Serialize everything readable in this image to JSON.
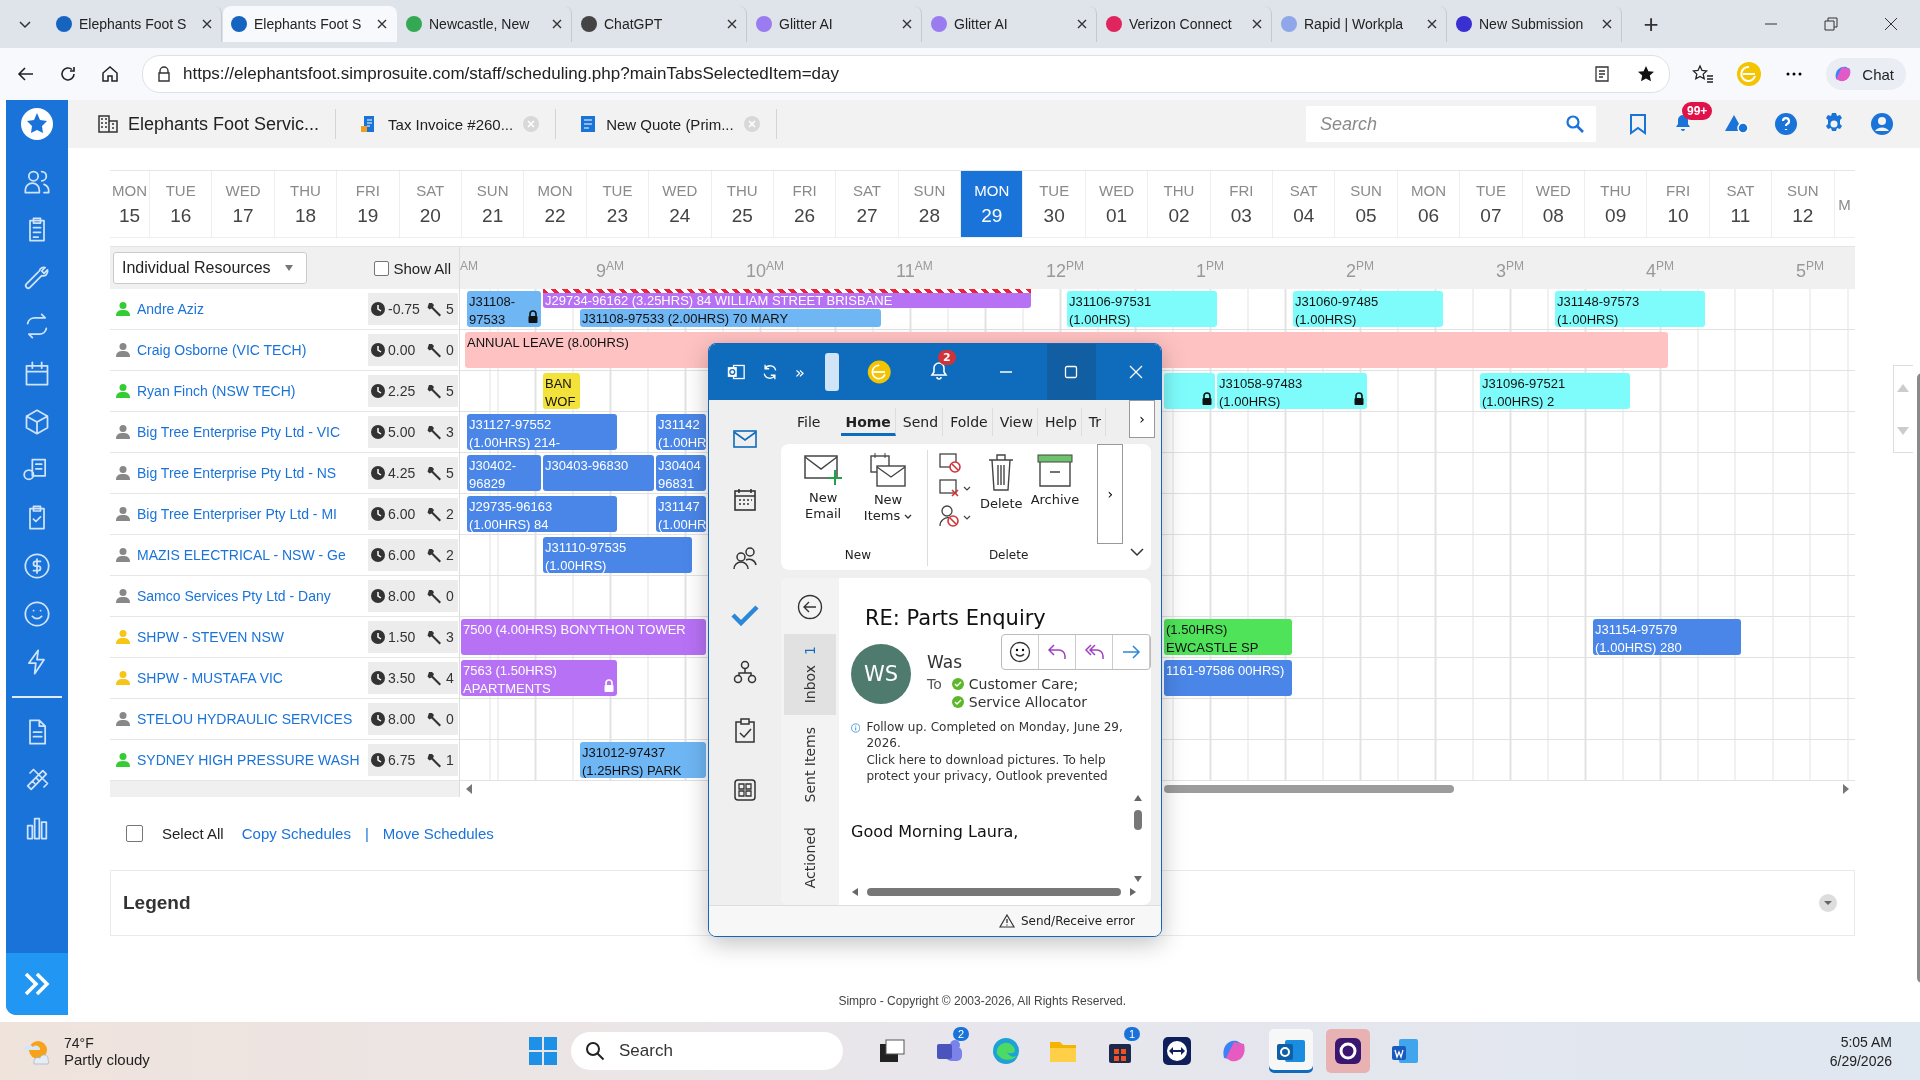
{
  "browser": {
    "tabs": [
      {
        "title": "Elephants Foot S",
        "selected": false,
        "color": "#1565c0"
      },
      {
        "title": "Elephants Foot S",
        "selected": true,
        "color": "#1565c0"
      },
      {
        "title": "Newcastle, New",
        "selected": false,
        "color": "#34a853"
      },
      {
        "title": "ChatGPT",
        "selected": false,
        "color": "#444444"
      },
      {
        "title": "Glitter AI",
        "selected": false,
        "color": "#9b7bf0"
      },
      {
        "title": "Glitter AI",
        "selected": false,
        "color": "#9b7bf0"
      },
      {
        "title": "Verizon Connect",
        "selected": false,
        "color": "#e0245e"
      },
      {
        "title": "Rapid | Workpla",
        "selected": false,
        "color": "#8fa6e8"
      },
      {
        "title": "New Submission",
        "selected": false,
        "color": "#3a2fd0"
      }
    ],
    "new_tab": "+",
    "address": "https://elephantsfoot.simprosuite.com/staff/scheduling.php?mainTabsSelectedItem=day",
    "chat": "Chat"
  },
  "app_header": {
    "tabs": [
      {
        "label": "Elephants Foot Servic...",
        "kind": "company"
      },
      {
        "label": "Tax Invoice #260...",
        "kind": "invoice"
      },
      {
        "label": "New Quote (Prim...",
        "kind": "quote"
      }
    ],
    "search": {
      "placeholder": "Search"
    },
    "notifications": "99+"
  },
  "dates": [
    {
      "weekday": "MON",
      "day": "15",
      "selected": false
    },
    {
      "weekday": "TUE",
      "day": "16",
      "selected": false
    },
    {
      "weekday": "WED",
      "day": "17",
      "selected": false
    },
    {
      "weekday": "THU",
      "day": "18",
      "selected": false
    },
    {
      "weekday": "FRI",
      "day": "19",
      "selected": false
    },
    {
      "weekday": "SAT",
      "day": "20",
      "selected": false
    },
    {
      "weekday": "SUN",
      "day": "21",
      "selected": false
    },
    {
      "weekday": "MON",
      "day": "22",
      "selected": false
    },
    {
      "weekday": "TUE",
      "day": "23",
      "selected": false
    },
    {
      "weekday": "WED",
      "day": "24",
      "selected": false
    },
    {
      "weekday": "THU",
      "day": "25",
      "selected": false
    },
    {
      "weekday": "FRI",
      "day": "26",
      "selected": false
    },
    {
      "weekday": "SAT",
      "day": "27",
      "selected": false
    },
    {
      "weekday": "SUN",
      "day": "28",
      "selected": false
    },
    {
      "weekday": "MON",
      "day": "29",
      "selected": true
    },
    {
      "weekday": "TUE",
      "day": "30",
      "selected": false
    },
    {
      "weekday": "WED",
      "day": "01",
      "selected": false
    },
    {
      "weekday": "THU",
      "day": "02",
      "selected": false
    },
    {
      "weekday": "FRI",
      "day": "03",
      "selected": false
    },
    {
      "weekday": "SAT",
      "day": "04",
      "selected": false
    },
    {
      "weekday": "SUN",
      "day": "05",
      "selected": false
    },
    {
      "weekday": "MON",
      "day": "06",
      "selected": false
    },
    {
      "weekday": "TUE",
      "day": "07",
      "selected": false
    },
    {
      "weekday": "WED",
      "day": "08",
      "selected": false
    },
    {
      "weekday": "THU",
      "day": "09",
      "selected": false
    },
    {
      "weekday": "FRI",
      "day": "10",
      "selected": false
    },
    {
      "weekday": "SAT",
      "day": "11",
      "selected": false
    },
    {
      "weekday": "SUN",
      "day": "12",
      "selected": false
    },
    {
      "weekday": "M",
      "selected": false
    }
  ],
  "scheduler": {
    "mode": "Individual Resources",
    "show_all": {
      "label": "Show All",
      "checked": false
    },
    "hours": [
      "$^{AM}$",
      "9$^{AM}$",
      "10$^{AM}$",
      "11$^{AM}$",
      "12$^{PM}$",
      "1$^{PM}$",
      "2$^{PM}$",
      "3$^{PM}$",
      "4$^{PM}$",
      "5$^{PM}$"
    ],
    "rows": [
      {
        "name": "Andre Aziz",
        "color": "#33cc33",
        "hours": "-0.75",
        "jobs_count": "5",
        "jobs": [
          {
            "text": "J31108-97533",
            "kind": "full",
            "color": "#6fb6f5",
            "locked": true,
            "flagged": false
          },
          {
            "text": "J29734-96162 (3.25HRS) 84 WILLIAM STREET BRISBANE",
            "kind": "top",
            "color": "#b771f5",
            "locked": false,
            "flagged": true
          },
          {
            "text": "J31108-97533 (2.00HRS) 70 MARY",
            "kind": "bottom",
            "color": "#6fb6f5",
            "locked": false,
            "flagged": false
          },
          {
            "text": "J31106-97531 (1.00HRS)",
            "kind": "full",
            "color": "#7efcfc",
            "locked": false,
            "flagged": false
          },
          {
            "text": "J31060-97485 (1.00HRS)",
            "kind": "full",
            "color": "#7efcfc",
            "locked": false,
            "flagged": false
          },
          {
            "text": "J31148-97573 (1.00HRS)",
            "kind": "full",
            "color": "#7efcfc",
            "locked": false,
            "flagged": false
          }
        ]
      },
      {
        "name": "Craig Osborne (VIC TECH)",
        "color": "#888888",
        "hours": "0.00",
        "jobs_count": "0",
        "jobs": [
          {
            "text": "ANNUAL LEAVE (8.00HRS)",
            "kind": "full",
            "color": "#ffc2c2",
            "locked": false,
            "flagged": false
          }
        ]
      },
      {
        "name": "Ryan Finch (NSW TECH)",
        "color": "#33cc33",
        "hours": "2.25",
        "jobs_count": "5",
        "jobs": [
          {
            "text": "BAN WOF",
            "kind": "full",
            "color": "#f3e23a",
            "locked": false,
            "flagged": false
          },
          {
            "kind": "full",
            "color": "#7efcfc",
            "locked": true,
            "flagged": false
          },
          {
            "text": "J31058-97483 (1.00HRS)",
            "kind": "full",
            "color": "#7efcfc",
            "locked": true,
            "flagged": false
          },
          {
            "text": "J31096-97521 (1.00HRS) 2",
            "kind": "full",
            "color": "#7efcfc",
            "locked": false,
            "flagged": false
          }
        ]
      },
      {
        "name": "Big Tree Enterprise Pty Ltd - VIC",
        "color": "#888888",
        "hours": "5.00",
        "jobs_count": "3",
        "jobs": [
          {
            "text": "J31127-97552 (1.00HRS) 214-",
            "kind": "full",
            "color": "#4a86e8",
            "locked": false,
            "flagged": false
          },
          {
            "text": "J31142 (1.00HR",
            "kind": "full",
            "color": "#4a86e8",
            "locked": false,
            "flagged": false
          }
        ]
      },
      {
        "name": "Big Tree Enterprise Pty Ltd - NS",
        "color": "#888888",
        "hours": "4.25",
        "jobs_count": "5",
        "jobs": [
          {
            "text": "J30402-96829",
            "kind": "full",
            "color": "#4a86e8",
            "locked": false,
            "flagged": false
          },
          {
            "text": "J30403-96830",
            "kind": "full",
            "color": "#4a86e8",
            "locked": false,
            "flagged": false
          },
          {
            "text": "J30404 96831",
            "kind": "full",
            "color": "#4a86e8",
            "locked": false,
            "flagged": false
          }
        ]
      },
      {
        "name": "Big Tree Enterpriser Pty Ltd - MI",
        "color": "#888888",
        "hours": "6.00",
        "jobs_count": "2",
        "jobs": [
          {
            "text": "J29735-96163 (1.00HRS) 84",
            "kind": "full",
            "color": "#4a86e8",
            "locked": false,
            "flagged": false
          },
          {
            "text": "J31147 (1.00HR",
            "kind": "full",
            "color": "#4a86e8",
            "locked": false,
            "flagged": false
          }
        ]
      },
      {
        "name": "MAZIS ELECTRICAL - NSW - Ge",
        "color": "#888888",
        "hours": "6.00",
        "jobs_count": "2",
        "jobs": [
          {
            "text": "J31110-97535 (1.00HRS)",
            "kind": "full",
            "color": "#4a86e8",
            "locked": false,
            "flagged": false
          }
        ]
      },
      {
        "name": "Samco Services Pty Ltd - Dany",
        "color": "#888888",
        "hours": "8.00",
        "jobs_count": "0",
        "jobs": []
      },
      {
        "name": "SHPW - STEVEN NSW",
        "color": "#f5c518",
        "hours": "1.50",
        "jobs_count": "3",
        "jobs": [
          {
            "text": "7500 (4.00HRS) BONYTHON TOWER",
            "kind": "full",
            "color": "#b771f5",
            "locked": false,
            "flagged": false
          },
          {
            "text": "(1.50HRS) EWCASTLE SP",
            "kind": "full",
            "color": "#4fe35a",
            "locked": false,
            "flagged": false
          },
          {
            "text": "J31154-97579 (1.00HRS) 280",
            "kind": "full",
            "color": "#4a86e8",
            "locked": false,
            "flagged": false
          }
        ]
      },
      {
        "name": "SHPW - MUSTAFA VIC",
        "color": "#f5c518",
        "hours": "3.50",
        "jobs_count": "4",
        "jobs": [
          {
            "text": "7563 (1.50HRS) APARTMENTS",
            "kind": "full",
            "color": "#b771f5",
            "locked": true,
            "flagged": false
          },
          {
            "text": "1161-97586 00HRS)",
            "kind": "full",
            "color": "#4a86e8",
            "locked": false,
            "flagged": false
          }
        ]
      },
      {
        "name": "STELOU HYDRAULIC SERVICES",
        "color": "#888888",
        "hours": "8.00",
        "jobs_count": "0",
        "jobs": []
      },
      {
        "name": "SYDNEY HIGH PRESSURE WASH",
        "color": "#33cc33",
        "hours": "6.75",
        "jobs_count": "1",
        "jobs": [
          {
            "text": "J31012-97437\n(1.25HRS) PARK",
            "kind": "full",
            "color": "#6fb6f5",
            "locked": false,
            "flagged": false
          }
        ]
      }
    ]
  },
  "actions": {
    "select_all": {
      "label": "Select All",
      "checked": false
    },
    "links": [
      "Copy Schedules",
      "Move Schedules"
    ],
    "separator": "|"
  },
  "legend": {
    "title": "Legend",
    "expanded": false
  },
  "footer": "Simpro - Copyright © 2003-2026, All Rights Reserved.",
  "outlook": {
    "title_more": "»",
    "bell_badge": "2",
    "menu": [
      {
        "label": "File",
        "selected": false
      },
      {
        "label": "Home",
        "selected": true
      },
      {
        "label": "Send",
        "selected": false
      },
      {
        "label": "Folde",
        "selected": false
      },
      {
        "label": "View",
        "selected": false
      },
      {
        "label": "Help",
        "selected": false
      },
      {
        "label": "Tr",
        "selected": false
      }
    ],
    "menu_more": "›",
    "ribbon": {
      "new_email": "New Email",
      "new_items": "New Items",
      "new_group": "New",
      "delete": "Delete",
      "archive": "Archive",
      "delete_group": "Delete",
      "more": "›"
    },
    "folders": [
      {
        "label": "Inbox",
        "count": "1",
        "selected": true
      },
      {
        "label": "Sent Items",
        "selected": false
      },
      {
        "label": "Actioned",
        "selected": false
      }
    ],
    "message": {
      "subject": "RE: Parts Enquiry",
      "initials": "WS",
      "sender": "Was",
      "to_label": "To",
      "recipients": [
        "Customer Care;",
        "Service Allocator"
      ],
      "info": "Follow up.  Completed on Monday, June 29, 2026.",
      "notice": "Click here to download pictures. To help protect your privacy, Outlook prevented",
      "body": "Good Morning Laura,"
    },
    "status": "Send/Receive error"
  },
  "taskbar": {
    "weather": {
      "temp": "74°F",
      "text": "Partly cloudy"
    },
    "search": "Search",
    "apps": [
      {
        "kind": "taskview",
        "selected": false,
        "flashing": false
      },
      {
        "kind": "teams",
        "badge": "2",
        "selected": false,
        "flashing": false
      },
      {
        "kind": "edge",
        "selected": false,
        "flashing": false
      },
      {
        "kind": "folder",
        "selected": false,
        "flashing": false
      },
      {
        "kind": "store",
        "badge": "1",
        "selected": false,
        "flashing": false
      },
      {
        "kind": "remote",
        "selected": false,
        "flashing": false
      },
      {
        "kind": "copilot",
        "selected": false,
        "flashing": false
      },
      {
        "kind": "outlook",
        "selected": true,
        "flashing": false
      },
      {
        "kind": "glitter",
        "selected": false,
        "flashing": true
      },
      {
        "kind": "word",
        "selected": false,
        "flashing": false
      }
    ],
    "time": "5:05 AM",
    "date": "6/29/2026"
  }
}
